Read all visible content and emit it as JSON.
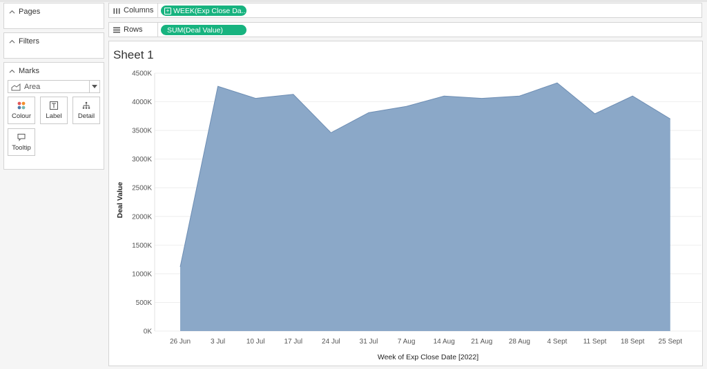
{
  "panel": {
    "pages_label": "Pages",
    "filters_label": "Filters",
    "marks_label": "Marks",
    "mark_type": "Area",
    "mark_buttons": {
      "colour": "Colour",
      "label": "Label",
      "detail": "Detail",
      "tooltip": "Tooltip"
    }
  },
  "shelves": {
    "columns_label": "Columns",
    "columns_pill": "WEEK(Exp Close Da...",
    "rows_label": "Rows",
    "rows_pill": "SUM(Deal Value)"
  },
  "colors": {
    "accent": "#17b37f",
    "area": "#8ba8c8",
    "area_line": "#6d8db3"
  },
  "sheet": {
    "title": "Sheet 1"
  },
  "chart_data": {
    "type": "area",
    "xlabel": "Week of Exp Close Date [2022]",
    "ylabel": "Deal Value",
    "categories": [
      "26 Jun",
      "3 Jul",
      "10 Jul",
      "17 Jul",
      "24 Jul",
      "31 Jul",
      "7 Aug",
      "14 Aug",
      "21 Aug",
      "28 Aug",
      "4 Sept",
      "11 Sept",
      "18 Sept",
      "25 Sept"
    ],
    "series": [
      {
        "values": [
          1120,
          4270,
          4060,
          4130,
          3460,
          3810,
          3920,
          4100,
          4060,
          4100,
          4330,
          3790,
          4100,
          3700
        ]
      }
    ],
    "unit": "K",
    "yticks": [
      0,
      500,
      1000,
      1500,
      2000,
      2500,
      3000,
      3500,
      4000,
      4500
    ],
    "ytick_labels": [
      "0K",
      "500K",
      "1000K",
      "1500K",
      "2000K",
      "2500K",
      "3000K",
      "3500K",
      "4000K",
      "4500K"
    ],
    "ylim": [
      0,
      4500
    ],
    "grid": true
  }
}
